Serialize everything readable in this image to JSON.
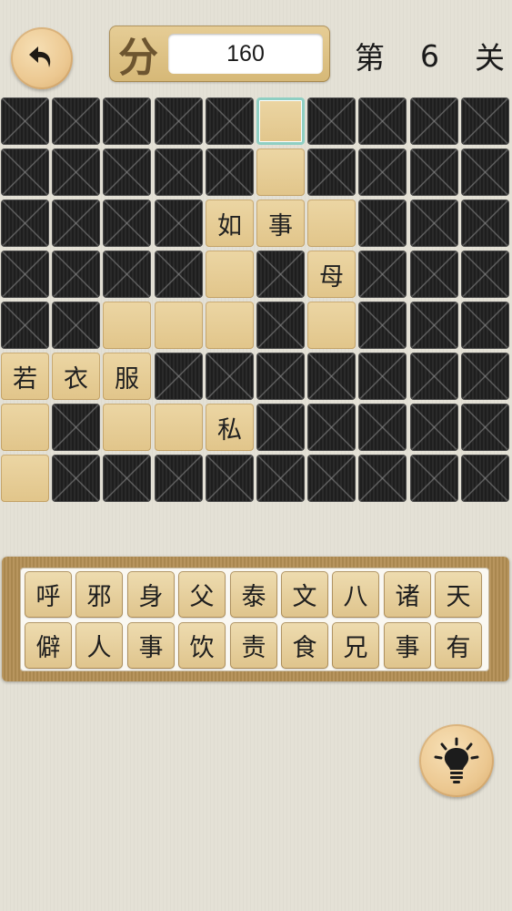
{
  "header": {
    "undo_icon": "undo-arrow-icon",
    "score_icon_text": "分",
    "score": "160",
    "level": {
      "prefix": "第",
      "number": "6",
      "suffix": "关"
    }
  },
  "board": {
    "rows": 8,
    "cols": 10,
    "cells": [
      {
        "r": 0,
        "c": 5,
        "text": "",
        "selected": true
      },
      {
        "r": 1,
        "c": 5,
        "text": ""
      },
      {
        "r": 2,
        "c": 4,
        "text": "如"
      },
      {
        "r": 2,
        "c": 5,
        "text": "事"
      },
      {
        "r": 2,
        "c": 6,
        "text": ""
      },
      {
        "r": 3,
        "c": 4,
        "text": ""
      },
      {
        "r": 3,
        "c": 6,
        "text": "母"
      },
      {
        "r": 4,
        "c": 2,
        "text": ""
      },
      {
        "r": 4,
        "c": 3,
        "text": ""
      },
      {
        "r": 4,
        "c": 4,
        "text": ""
      },
      {
        "r": 4,
        "c": 6,
        "text": ""
      },
      {
        "r": 5,
        "c": 0,
        "text": "若"
      },
      {
        "r": 5,
        "c": 1,
        "text": "衣"
      },
      {
        "r": 5,
        "c": 2,
        "text": "服"
      },
      {
        "r": 6,
        "c": 0,
        "text": ""
      },
      {
        "r": 6,
        "c": 2,
        "text": ""
      },
      {
        "r": 6,
        "c": 3,
        "text": ""
      },
      {
        "r": 6,
        "c": 4,
        "text": "私"
      },
      {
        "r": 7,
        "c": 0,
        "text": ""
      }
    ]
  },
  "tray": {
    "tiles": [
      [
        "呼",
        "邪",
        "身",
        "父",
        "泰",
        "文",
        "八",
        "诸",
        "天"
      ],
      [
        "僻",
        "人",
        "事",
        "饮",
        "责",
        "食",
        "兄",
        "事",
        "有"
      ]
    ]
  },
  "hint": {
    "icon": "lightbulb-icon"
  },
  "colors": {
    "background": "#e4e1d6",
    "open_cell": "#e6cd95",
    "blocked_cell": "#262626",
    "tray_wood": "#b08e56",
    "selected_outline": "#8fcfc3"
  }
}
